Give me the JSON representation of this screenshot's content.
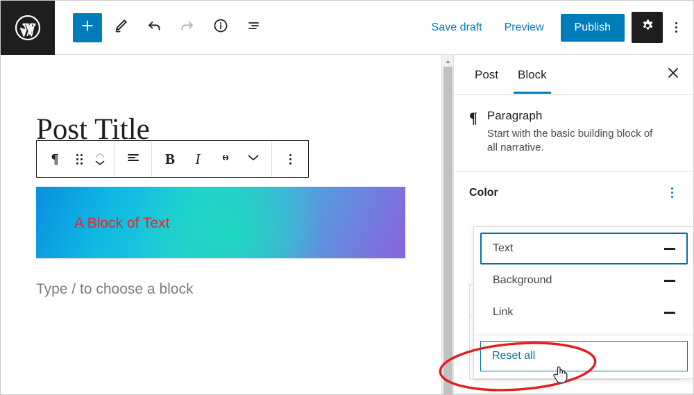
{
  "topbar": {
    "logo_icon": "wordpress-logo-icon",
    "left_tools": [
      {
        "name": "add-block-button",
        "icon": "plus-icon",
        "label": "+"
      },
      {
        "name": "edit-tool-button",
        "icon": "pencil-icon",
        "label": ""
      },
      {
        "name": "undo-button",
        "icon": "undo-arrow-icon",
        "label": ""
      },
      {
        "name": "redo-button",
        "icon": "redo-arrow-icon",
        "label": ""
      },
      {
        "name": "details-button",
        "icon": "info-circle-icon",
        "label": ""
      },
      {
        "name": "list-view-button",
        "icon": "list-view-icon",
        "label": ""
      }
    ],
    "save_draft_label": "Save draft",
    "preview_label": "Preview",
    "publish_label": "Publish",
    "settings_icon": "gear-icon",
    "options_icon": "kebab-menu-icon",
    "accent_color": "#007cba",
    "dark_color": "#1e1e1e"
  },
  "editor": {
    "post_title": "Post Title",
    "block_toolbar": [
      {
        "name": "block-type-paragraph-button",
        "icon": "paragraph-icon",
        "glyph": "¶"
      },
      {
        "name": "drag-handle",
        "icon": "drag-dots-icon",
        "glyph": ""
      },
      {
        "name": "move-updown-buttons",
        "icon": "chevron-up-down-icon",
        "glyph": ""
      },
      {
        "name": "align-text-button",
        "icon": "align-left-icon",
        "glyph": ""
      },
      {
        "name": "bold-button",
        "icon": "bold-icon",
        "glyph": "B"
      },
      {
        "name": "italic-button",
        "icon": "italic-icon",
        "glyph": "I"
      },
      {
        "name": "link-button",
        "icon": "link-icon",
        "glyph": ""
      },
      {
        "name": "more-formatting-button",
        "icon": "chevron-down-icon",
        "glyph": ""
      },
      {
        "name": "block-options-button",
        "icon": "kebab-menu-icon",
        "glyph": ""
      }
    ],
    "gradient_block_text": "A Block of Text",
    "gradient_block_text_color": "#e8242a",
    "gradient_colors": [
      "#0a8fe0",
      "#10bbe3",
      "#22cfd6",
      "#1fd9bf",
      "#4fa3de",
      "#8a63dd"
    ],
    "empty_block_placeholder": "Type / to choose a block"
  },
  "sidebar": {
    "tabs": [
      {
        "label": "Post",
        "active": false
      },
      {
        "label": "Block",
        "active": true
      }
    ],
    "close_icon": "close-x-icon",
    "block_info": {
      "icon": "paragraph-icon",
      "icon_glyph": "¶",
      "title": "Paragraph",
      "description": "Start with the basic building block of all narrative."
    },
    "color_section": {
      "title": "Color",
      "menu_icon": "kebab-menu-icon",
      "menu_color": "#007cba"
    }
  },
  "dropdown": {
    "items": [
      {
        "label": "Text",
        "focused": true,
        "trailing_icon": "dash-icon"
      },
      {
        "label": "Background",
        "focused": false,
        "trailing_icon": "dash-icon"
      },
      {
        "label": "Link",
        "focused": false,
        "trailing_icon": "dash-icon"
      }
    ],
    "reset_all_label": "Reset all",
    "reset_all_color": "#0071a1"
  },
  "annotation": {
    "shape": "red-ellipse-highlight",
    "color": "#e81b1b",
    "cursor_icon": "pointing-hand-cursor"
  },
  "scrollbar": {
    "up_arrow_icon": "triangle-up-icon",
    "thumb_color": "#c1c1c1"
  }
}
